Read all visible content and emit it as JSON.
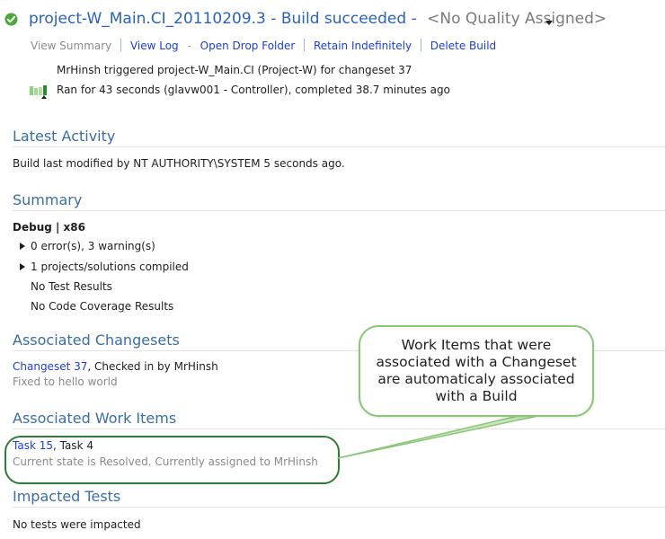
{
  "header": {
    "build_name": "project-W_Main.CI_20110209.3",
    "build_status": " - Build succeeded - ",
    "quality": "<No Quality Assigned>",
    "status_icon": "check-circle-icon",
    "dropdown_icon": "triangle-down-icon",
    "actions": {
      "view_summary": "View Summary",
      "view_log": "View Log",
      "open_drop_folder": "Open Drop Folder",
      "retain_indefinitely": "Retain Indefinitely",
      "delete_build": "Delete Build"
    },
    "triggered_by": "MrHinsh triggered project-W_Main.CI (Project-W) for changeset 37",
    "run_info": "Ran for 43 seconds (glavw001 - Controller), completed 38.7 minutes ago",
    "run_icon": "build-bars-icon"
  },
  "latest_activity": {
    "heading": "Latest Activity",
    "text": "Build last modified by NT AUTHORITY\\SYSTEM 5 seconds ago."
  },
  "summary": {
    "heading": "Summary",
    "config": "Debug | x86",
    "errors": "0 error(s), 3 warning(s)",
    "projects": "1 projects/solutions compiled",
    "tests": "No Test Results",
    "coverage": "No Code Coverage Results"
  },
  "changesets": {
    "heading": "Associated Changesets",
    "link": "Changeset 37",
    "by": ", Checked in by MrHinsh",
    "comment": "Fixed to hello world"
  },
  "work_items": {
    "heading": "Associated Work Items",
    "task1": "Task 15",
    "task2": ", Task 4",
    "state": "Current state is Resolved. Currently assigned to MrHinsh"
  },
  "impacted_tests": {
    "heading": "Impacted Tests",
    "text": "No tests were impacted"
  },
  "callout": {
    "text": "Work Items that were associated with a Changeset are automaticaly associated with a Build",
    "border_color": "#8cc679"
  }
}
